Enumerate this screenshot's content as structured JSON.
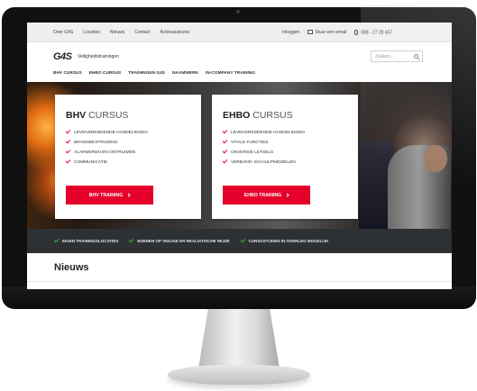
{
  "topbar": {
    "nav": [
      "Over G4S",
      "Locaties",
      "Nieuws",
      "Contact",
      "Actievacatures"
    ],
    "login": "Inloggen",
    "email_label": "Stuur een email",
    "phone": "088 - 27 28 457"
  },
  "header": {
    "logo_main": "G4S",
    "logo_sub": "Veiligheidstrainingen",
    "search_placeholder": "Zoeken..."
  },
  "mainnav": [
    "BHV CURSUS",
    "EHBO CURSUS",
    "TRAININGEN G4S",
    "NAAMWERK",
    "IN-COMPANY TRAINING"
  ],
  "cards": {
    "bhv": {
      "title_bold": "BHV",
      "title_light": "CURSUS",
      "items": [
        "LEVENSREDDENDE HANDELINGEN",
        "BRANDBESTRIJDING",
        "ALARMEREN EN ONTRUIMEN",
        "COMMUNICATIE"
      ],
      "button": "BHV TRAINING"
    },
    "ehbo": {
      "title_bold": "EHBO",
      "title_light": "CURSUS",
      "items": [
        "LEVENSREDDENDE HANDELINGEN",
        "VITALE FUNCTIES",
        "ONVERSIE LETSELS",
        "VERBAND- EN HULPMIDDELEN"
      ],
      "button": "EHBO TRAINING"
    }
  },
  "usps": [
    "EIGEN TRAININGSLOCATIES",
    "EDENEN OP VEILIGE EN REALISTISCHE WIJZE",
    "CURSUSTIJDEN IN OVERLEG MOGELIJK"
  ],
  "news": {
    "title": "Nieuws"
  },
  "colors": {
    "accent": "#e4002b",
    "usp_bar": "#2e3134",
    "check_green": "#3cb34a"
  }
}
